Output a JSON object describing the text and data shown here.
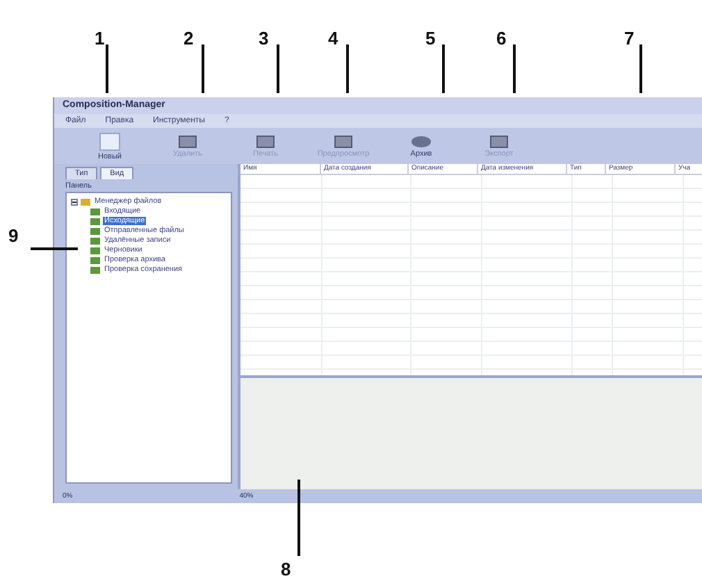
{
  "callouts": [
    {
      "label": "1"
    },
    {
      "label": "2"
    },
    {
      "label": "3"
    },
    {
      "label": "4"
    },
    {
      "label": "5"
    },
    {
      "label": "6"
    },
    {
      "label": "7"
    },
    {
      "label": "8"
    },
    {
      "label": "9"
    }
  ],
  "window": {
    "title": "Composition-Manager"
  },
  "menu": [
    "Файл",
    "Правка",
    "Инструменты",
    "?"
  ],
  "toolbar": [
    {
      "label": "Новый",
      "disabled": false
    },
    {
      "label": "Удалить",
      "disabled": true
    },
    {
      "label": "Печать",
      "disabled": true
    },
    {
      "label": "Предпросмотр",
      "disabled": true
    },
    {
      "label": "Архив",
      "disabled": false
    },
    {
      "label": "Экспорт",
      "disabled": true
    }
  ],
  "panel_tabs": [
    {
      "label": "Тип",
      "selected": true
    },
    {
      "label": "Вид",
      "selected": false
    }
  ],
  "panel_label": "Панель",
  "tree": [
    {
      "label": "Менеджер файлов",
      "expanded": true,
      "selected": false,
      "children": [
        {
          "label": "Входящие",
          "selected": false
        },
        {
          "label": "Исходящие",
          "selected": true
        },
        {
          "label": "Отправленные файлы",
          "selected": false
        },
        {
          "label": "Удалённые записи",
          "selected": false
        },
        {
          "label": "Черновики",
          "selected": false
        },
        {
          "label": "Проверка архива",
          "selected": false
        },
        {
          "label": "Проверка сохранения",
          "selected": false
        }
      ]
    }
  ],
  "table": {
    "columns": [
      "Имя",
      "Дата создания",
      "Описание",
      "Дата изменения",
      "Тип",
      "Размер",
      "Уча"
    ]
  },
  "status_bar": [
    "0%",
    "40%"
  ]
}
